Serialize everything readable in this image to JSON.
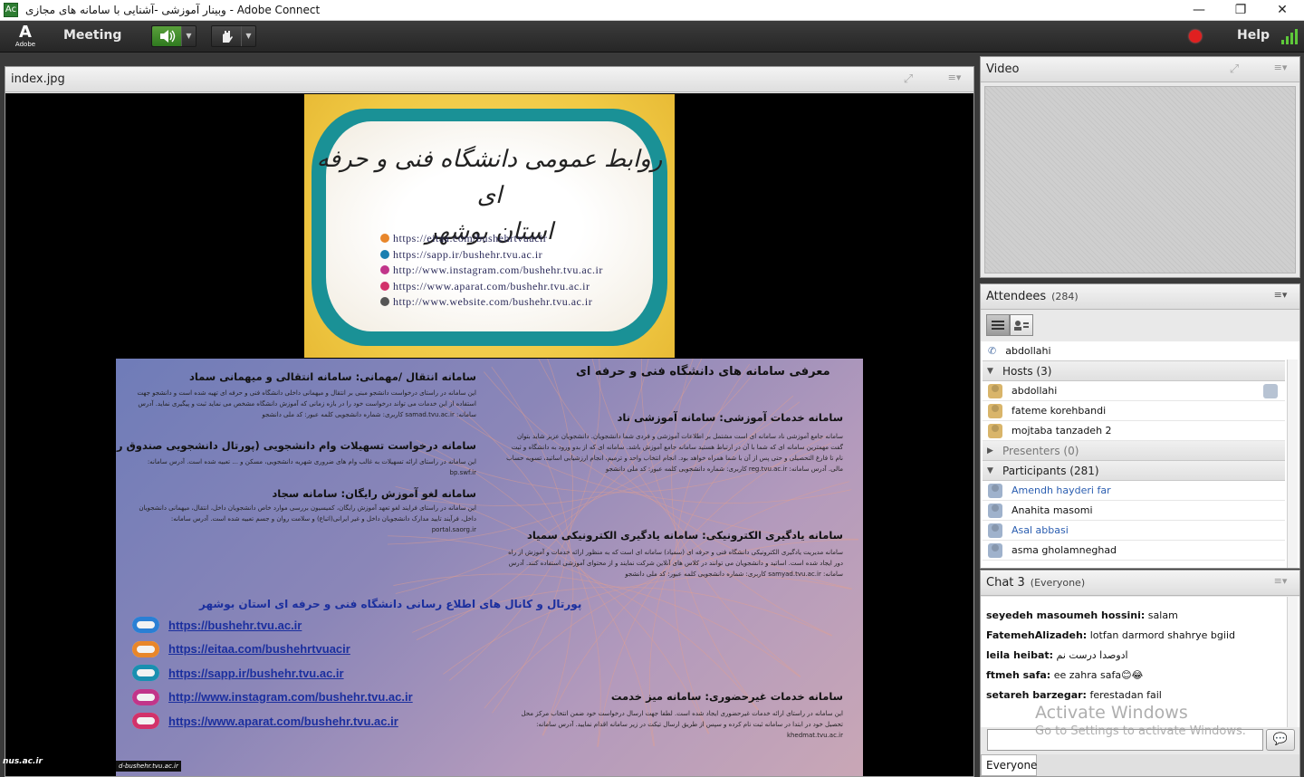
{
  "window": {
    "title": "وبینار آموزشی -آشنایی با سامانه های مجازی - Adobe Connect",
    "controls": [
      "—",
      "❐",
      "✕"
    ]
  },
  "menubar": {
    "logo_text": "Adobe",
    "meeting_label": "Meeting",
    "help_label": "Help"
  },
  "share_pod": {
    "title": "index.jpg",
    "top_image": {
      "calligraphy_line1": "روابط عمومی دانشگاه فنی و حرفه ای",
      "calligraphy_line2": "استان بوشهر",
      "links": [
        "https://eitaa.com/bushehrtvuacir",
        "https://sapp.ir/bushehr.tvu.ac.ir",
        "http://www.instagram.com/bushehr.tvu.ac.ir",
        "https://www.aparat.com/bushehr.tvu.ac.ir",
        "http://www.website.com/bushehr.tvu.ac.ir"
      ],
      "link_colors": [
        "#e8862a",
        "#1a7fb0",
        "#c1358a",
        "#d2326a",
        "#555555"
      ]
    },
    "bottom_image": {
      "intro_title": "معرفی سامانه های دانشگاه فنی و حرفه ای",
      "left_sections": [
        {
          "title": "سامانه انتقال /مهمانی: سامانه انتقالی و میهمانی سماد",
          "body": "این سامانه در راستای درخواست دانشجو مبنی بر انتقال و میهمانی داخلی دانشگاه فنی و حرفه ای تهیه شده است و دانشجو جهت استفاده از این خدمات می تواند درخواست خود را در بازه زمانی که آموزش دانشگاه مشخص می نماید ثبت و پیگیری نماید. آدرس سامانه: samad.tvu.ac.ir کاربری: شماره دانشجویی کلمه عبور: کد ملی دانشجو"
        },
        {
          "title": "سامانه درخواست تسهیلات وام دانشجویی (پورتال دانشجویی صندوق رفاه)",
          "body": "این سامانه در راستای ارائه تسهیلات به غالب وام های ضروری شهریه دانشجویی، مسکن و ... تعبیه شده است. آدرس سامانه: bp.swf.ir"
        },
        {
          "title": "سامانه لغو آموزش رایگان: سامانه سجاد",
          "body": "این سامانه در راستای فرایند لغو تعهد آموزش رایگان، کمیسیون بررسی موارد خاص دانشجویان داخل، انتقال، میهمانی دانشجویان داخل، فرآیند تایید مدارک دانشجویان داخل و غیر ایرانی(اتباع) و سلامت روان و جسم تعبیه شده است. آدرس سامانه: portal.saorg.ir"
        }
      ],
      "right_sections": [
        {
          "title": "سامانه خدمات آموزشی: سامانه آموزشی ناد",
          "body": "سامانه جامع آموزشی ناد سامانه ای است مشتمل بر اطلاعات آموزشی و فردی شما دانشجویان. دانشجویان عزیز شاید بتوان گفت مهمترین سامانه ای که شما با آن در ارتباط هستید سامانه جامع آموزش باشد. سامانه ای که از بدو ورود به دانشگاه و ثبت نام تا فارغ التحصیلی و حتی پس از آن با شما همراه خواهد بود. انجام انتخاب واحد و ترمیم، انجام ارزشیابی اساتید، تسویه حساب مالی. آدرس سامانه: reg.tvu.ac.ir کاربری: شماره دانشجویی کلمه عبور: کد ملی دانشجو"
        },
        {
          "title": "سامانه یادگیری الکترونیکی: سامانه یادگیری الکترونیکی سمیاد",
          "body": "سامانه مدیریت یادگیری الکترونیکی دانشگاه فنی و حرفه ای (سمیاد) سامانه ای است که به منظور ارائه خدمات و آموزش از راه دور ایجاد شده است. اساتید و دانشجویان می توانند در کلاس های آنلاین شرکت نمایند و از محتوای آموزشی استفاده کنند. آدرس سامانه: samyad.tvu.ac.ir کاربری: شماره دانشجویی کلمه عبور: کد ملی دانشجو"
        },
        {
          "title": "سامانه خدمات غیرحضوری: سامانه میز خدمت",
          "body": "این سامانه در راستای ارائه خدمات غیرحضوری ایجاد شده است. لطفا جهت ارسال درخواست خود ضمن انتخاب مرکز محل تحصیل خود در ابتدا در سامانه ثبت نام کرده و سپس از طریق ارسال تیکت در زیر سامانه اقدام نمایید. آدرس سامانه: khedmat.tvu.ac.ir"
        }
      ],
      "portal_title": "پورتال و کانال های اطلاع رسانی دانشگاه فنی و حرفه ای استان بوشهر",
      "portal_links": [
        "https://bushehr.tvu.ac.ir",
        "https://eitaa.com/bushehrtvuacir",
        "https://sapp.ir/bushehr.tvu.ac.ir",
        "http://www.instagram.com/bushehr.tvu.ac.ir",
        "https://www.aparat.com/bushehr.tvu.ac.ir"
      ],
      "portal_icon_colors": [
        "#2a7fd4",
        "#e8862a",
        "#1a8fb0",
        "#c1358a",
        "#d2326a"
      ],
      "footer_badge": "d-bushehr.tvu.ac.ir"
    },
    "left_watermark": "nus.ac.ir"
  },
  "video_pod": {
    "title": "Video"
  },
  "attendees_pod": {
    "title": "Attendees",
    "count": "(284)",
    "top_user": "abdollahi",
    "groups": {
      "hosts": "Hosts (3)",
      "presenters": "Presenters (0)",
      "participants": "Participants (281)"
    },
    "hosts": [
      "abdollahi",
      "fateme korehbandi",
      "mojtaba tanzadeh 2"
    ],
    "participants": [
      "Amendh hayderi far",
      "Anahita  masomi",
      "Asal abbasi",
      "asma gholamneghad"
    ]
  },
  "chat_pod": {
    "title": "Chat 3",
    "scope": "(Everyone)",
    "messages": [
      {
        "sender": "seyedeh masoumeh hossini:",
        "text": "salam"
      },
      {
        "sender": "FatemehAlizadeh:",
        "text": "lotfan darmord shahrye bgiid"
      },
      {
        "sender": "leila heibat:",
        "text": "ادوصدا درست نم"
      },
      {
        "sender": "ftmeh safa:",
        "text": "ee zahra safa😊😂"
      },
      {
        "sender": "setareh barzegar:",
        "text": "ferestadan fail"
      }
    ],
    "recipient": "Everyone"
  },
  "watermark": {
    "line1": "Activate Windows",
    "line2": "Go to Settings to activate Windows."
  }
}
